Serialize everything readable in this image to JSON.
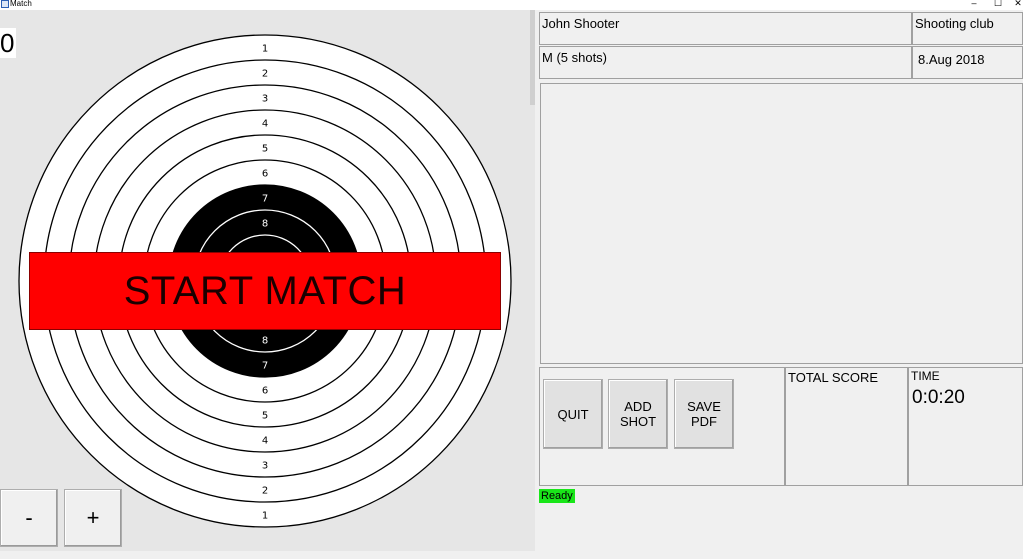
{
  "window": {
    "title": "Match",
    "controls": {
      "minimize": "–",
      "maximize": "☐",
      "close": "✕"
    }
  },
  "target": {
    "shot_count": "0",
    "ring_numbers_top": [
      "1",
      "2",
      "3",
      "4",
      "5",
      "6",
      "7",
      "8"
    ],
    "ring_numbers_bottom": [
      "8",
      "7",
      "6",
      "5",
      "4",
      "3",
      "2",
      "1"
    ],
    "start_button_label": "START MATCH",
    "zoom_out_label": "-",
    "zoom_in_label": "+"
  },
  "info": {
    "shooter_name": "John Shooter",
    "club": "Shooting club",
    "discipline": "M (5 shots)",
    "date": "8.Aug 2018"
  },
  "actions": {
    "quit_label": "QUIT",
    "add_shot_label": "ADD\nSHOT",
    "save_pdf_label": "SAVE\nPDF"
  },
  "score": {
    "total_score_label": "TOTAL SCORE",
    "time_label": "TIME",
    "time_value": "0:0:20"
  },
  "status": {
    "text": "Ready",
    "color": "#19e619"
  },
  "colors": {
    "start_banner": "#ff0000",
    "panel_background": "#e6e6e6",
    "window_background": "#f0f0f0"
  }
}
